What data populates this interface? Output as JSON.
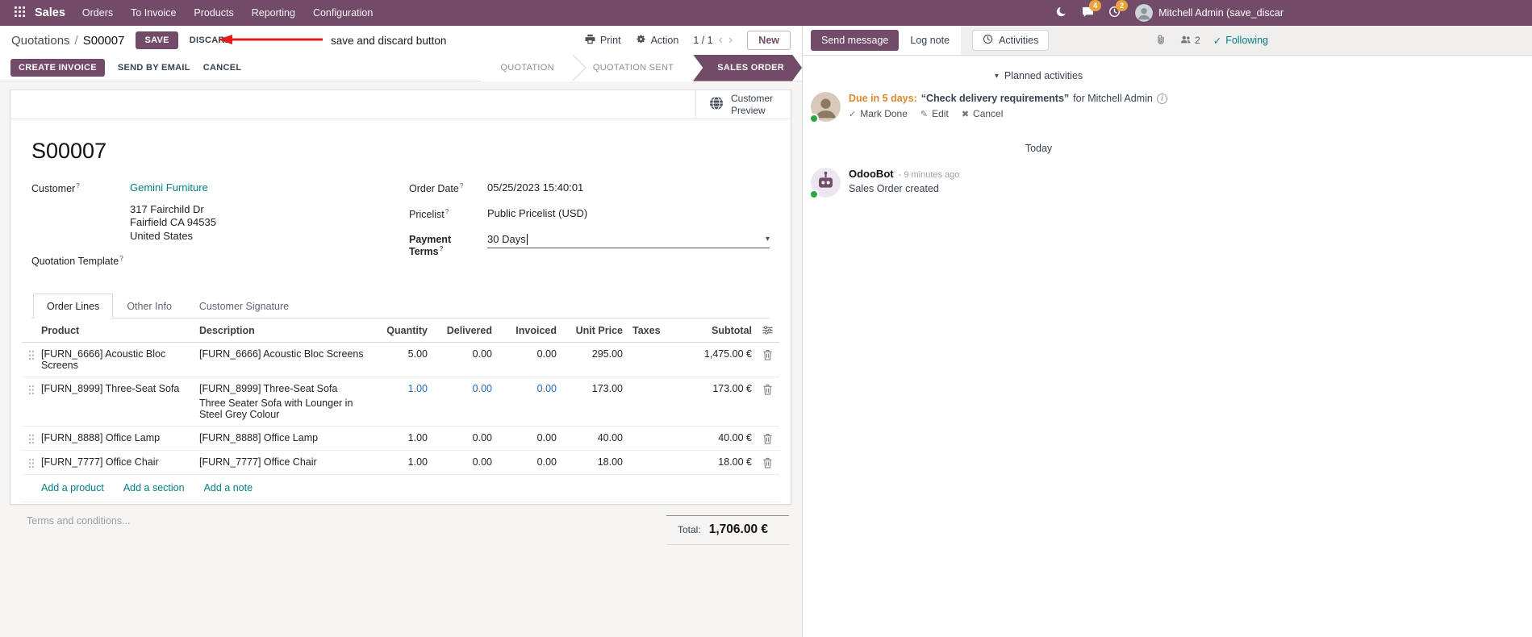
{
  "nav": {
    "brand": "Sales",
    "items": [
      "Orders",
      "To Invoice",
      "Products",
      "Reporting",
      "Configuration"
    ],
    "messages_badge": "4",
    "activities_badge": "2",
    "user_name": "Mitchell Admin (save_discar"
  },
  "control": {
    "breadcrumb_parent": "Quotations",
    "breadcrumb_sep": "/",
    "breadcrumb_current": "S00007",
    "save": "SAVE",
    "discard": "DISCARD",
    "print": "Print",
    "action": "Action",
    "pager": "1 / 1",
    "new": "New"
  },
  "annotation": {
    "label": "save and discard button"
  },
  "statusbar": {
    "create_invoice": "CREATE INVOICE",
    "send_by_email": "SEND BY EMAIL",
    "cancel": "CANCEL",
    "stages": [
      {
        "label": "QUOTATION"
      },
      {
        "label": "QUOTATION SENT"
      },
      {
        "label": "SALES ORDER"
      }
    ]
  },
  "form": {
    "customer_preview": "Customer Preview",
    "title": "S00007",
    "customer_label": "Customer",
    "customer_name": "Gemini Furniture",
    "address_line1": "317 Fairchild Dr",
    "address_line2": "Fairfield CA 94535",
    "address_line3": "United States",
    "quotation_template_label": "Quotation Template",
    "order_date_label": "Order Date",
    "order_date": "05/25/2023 15:40:01",
    "pricelist_label": "Pricelist",
    "pricelist": "Public Pricelist (USD)",
    "payment_terms_label": "Payment Terms",
    "payment_terms": "30 Days",
    "tabs": [
      {
        "label": "Order Lines"
      },
      {
        "label": "Other Info"
      },
      {
        "label": "Customer Signature"
      }
    ],
    "table": {
      "headers": {
        "product": "Product",
        "description": "Description",
        "quantity": "Quantity",
        "delivered": "Delivered",
        "invoiced": "Invoiced",
        "unit_price": "Unit Price",
        "taxes": "Taxes",
        "subtotal": "Subtotal"
      },
      "rows": [
        {
          "product": "[FURN_6666] Acoustic Bloc Screens",
          "description": "[FURN_6666] Acoustic Bloc Screens",
          "quantity": "5.00",
          "delivered": "0.00",
          "invoiced": "0.00",
          "unit_price": "295.00",
          "taxes": "",
          "subtotal": "1,475.00 €"
        },
        {
          "product": "[FURN_8999] Three-Seat Sofa",
          "description": "[FURN_8999] Three-Seat Sofa",
          "description_note": "Three Seater Sofa with Lounger in Steel Grey Colour",
          "quantity": "1.00",
          "delivered": "0.00",
          "invoiced": "0.00",
          "unit_price": "173.00",
          "taxes": "",
          "subtotal": "173.00 €"
        },
        {
          "product": "[FURN_8888] Office Lamp",
          "description": "[FURN_8888] Office Lamp",
          "quantity": "1.00",
          "delivered": "0.00",
          "invoiced": "0.00",
          "unit_price": "40.00",
          "taxes": "",
          "subtotal": "40.00 €"
        },
        {
          "product": "[FURN_7777] Office Chair",
          "description": "[FURN_7777] Office Chair",
          "quantity": "1.00",
          "delivered": "0.00",
          "invoiced": "0.00",
          "unit_price": "18.00",
          "taxes": "",
          "subtotal": "18.00 €"
        }
      ],
      "add_product": "Add a product",
      "add_section": "Add a section",
      "add_note": "Add a note"
    },
    "terms_placeholder": "Terms and conditions...",
    "total_label": "Total:",
    "total_value": "1,706.00 €"
  },
  "chatter": {
    "send_message": "Send message",
    "log_note": "Log note",
    "activities": "Activities",
    "followers_count": "2",
    "following": "Following",
    "planned_activities": "Planned activities",
    "activity": {
      "due": "Due in 5 days:",
      "summary": "“Check delivery requirements”",
      "assignee": "for Mitchell Admin",
      "mark_done": "Mark Done",
      "edit": "Edit",
      "cancel": "Cancel"
    },
    "date_divider": "Today",
    "message": {
      "author": "OdooBot",
      "timestamp": "- 9 minutes ago",
      "body": "Sales Order created"
    }
  },
  "colors": {
    "brand": "#714B67",
    "link": "#017E84",
    "modified_value": "#1F6ABF",
    "activity_due": "#D9892A",
    "annotation_arrow": "#E01B1B",
    "badge": "#E8A33D"
  },
  "icons": {
    "caret_down": "▾",
    "chevron_left": "‹",
    "chevron_right": "›",
    "check": "✓",
    "edit": "✎",
    "cancel_x": "✖",
    "info": "i",
    "help": "?"
  }
}
